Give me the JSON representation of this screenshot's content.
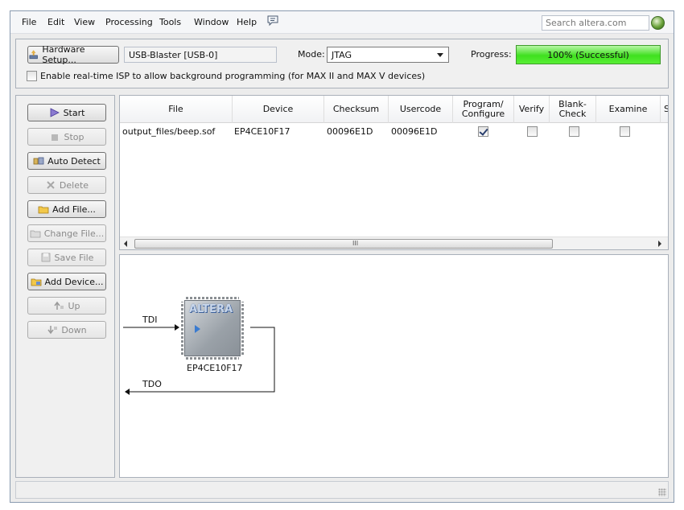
{
  "menu": {
    "items": [
      "File",
      "Edit",
      "View",
      "Processing",
      "Tools",
      "Window",
      "Help"
    ],
    "search_placeholder": "Search altera.com"
  },
  "hardware": {
    "setup_label": "Hardware Setup...",
    "device": "USB-Blaster [USB-0]",
    "mode_label": "Mode:",
    "mode_value": "JTAG",
    "progress_label": "Progress:",
    "progress_text": "100% (Successful)",
    "progress_value": 100,
    "isp_label": "Enable real-time ISP to allow background programming (for MAX II and MAX V devices)",
    "isp_checked": false
  },
  "actions": [
    {
      "label": "Start",
      "enabled": true,
      "icon": "start-icon"
    },
    {
      "label": "Stop",
      "enabled": false,
      "icon": "stop-icon"
    },
    {
      "label": "Auto Detect",
      "enabled": true,
      "icon": "auto-detect-icon"
    },
    {
      "label": "Delete",
      "enabled": false,
      "icon": "delete-icon"
    },
    {
      "label": "Add File...",
      "enabled": true,
      "icon": "add-file-icon"
    },
    {
      "label": "Change File...",
      "enabled": false,
      "icon": "change-file-icon"
    },
    {
      "label": "Save File",
      "enabled": false,
      "icon": "save-file-icon"
    },
    {
      "label": "Add Device...",
      "enabled": true,
      "icon": "add-device-icon"
    },
    {
      "label": "Up",
      "enabled": false,
      "icon": "up-icon"
    },
    {
      "label": "Down",
      "enabled": false,
      "icon": "down-icon"
    }
  ],
  "table": {
    "headers": {
      "file": "File",
      "device": "Device",
      "checksum": "Checksum",
      "usercode": "Usercode",
      "program_1": "Program/",
      "program_2": "Configure",
      "verify": "Verify",
      "blank_1": "Blank-",
      "blank_2": "Check",
      "examine": "Examine",
      "more": "S"
    },
    "row": {
      "file": "output_files/beep.sof",
      "device": "EP4CE10F17",
      "checksum": "00096E1D",
      "usercode": "00096E1D",
      "program_configure": true,
      "verify": false,
      "blank_check": false,
      "examine": false
    },
    "scroll_grip": "III"
  },
  "chain": {
    "tdi": "TDI",
    "tdo": "TDO",
    "chip_logo": "ALTERA",
    "device_name": "EP4CE10F17"
  },
  "colors": {
    "progress_green": "#3fe01f",
    "chip_blue": "#3a7bd0"
  }
}
